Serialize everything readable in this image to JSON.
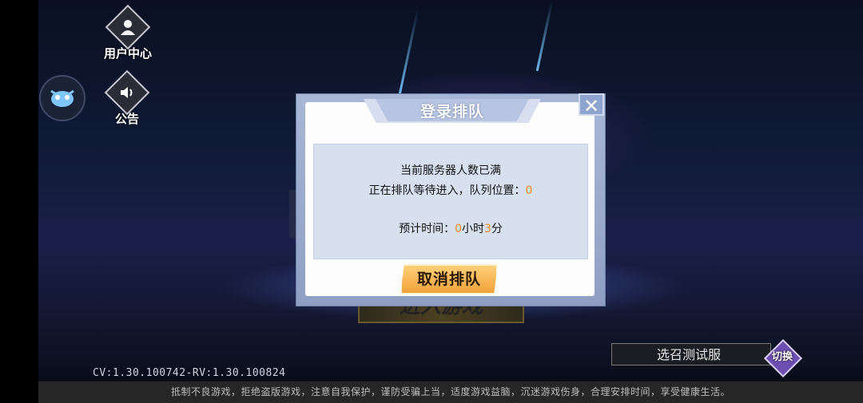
{
  "sidebar": {
    "user_center_label": "用户中心",
    "notice_label": "公告"
  },
  "dialog": {
    "title": "登录排队",
    "close_symbol": "✕",
    "line1": "当前服务器人数已满",
    "line2_prefix": "正在排队等待进入，队列位置：",
    "queue_position": "0",
    "eta_prefix": "预计时间：",
    "eta_hours": "0",
    "eta_hours_unit": "小时",
    "eta_minutes": "3",
    "eta_minutes_unit": "分",
    "cancel_label": "取消排队"
  },
  "background": {
    "enter_game_label": "进入游戏"
  },
  "server": {
    "name": "选召测试服",
    "switch_label": "切换"
  },
  "version": "CV:1.30.100742-RV:1.30.100824",
  "footer_notice": "抵制不良游戏，拒绝盗版游戏，注意自我保护，谨防受骗上当，适度游戏益脑，沉迷游戏伤身，合理安排时间，享受健康生活。",
  "colors": {
    "accent_orange": "#f08a1d",
    "dialog_frame": "#a8b6d6",
    "switch_purple": "#6c4fb0"
  },
  "icons": [
    "user-icon",
    "pet-icon",
    "speaker-icon",
    "close-icon"
  ]
}
